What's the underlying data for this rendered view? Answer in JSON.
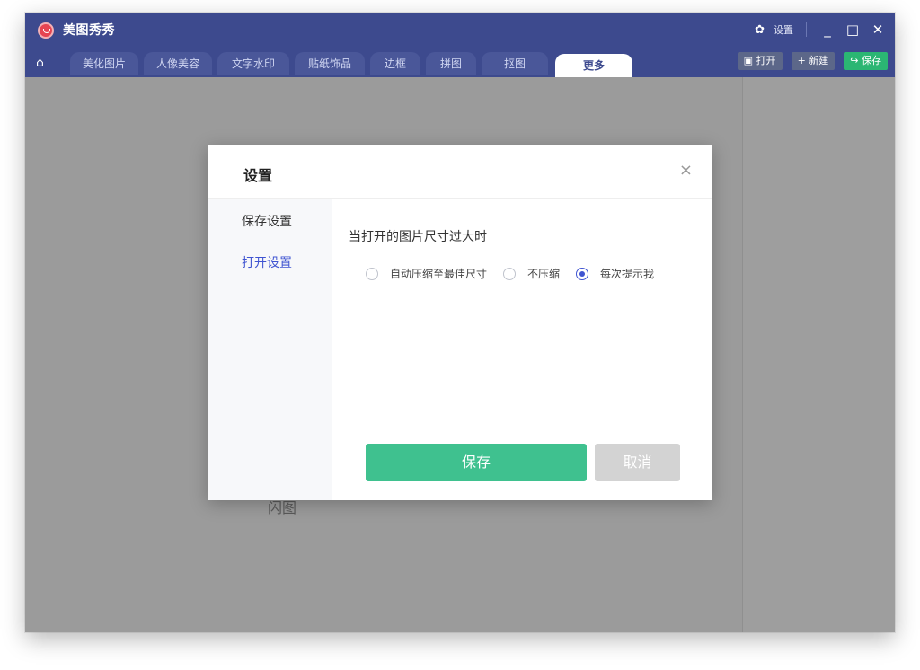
{
  "app": {
    "title": "美图秀秀",
    "settings_label": "设置",
    "window_controls": {
      "minimize": "_",
      "maximize": "□",
      "close": "✕"
    }
  },
  "tabs": {
    "items": [
      "美化图片",
      "人像美容",
      "文字水印",
      "贴纸饰品",
      "边框",
      "拼图",
      "抠图",
      "更多"
    ],
    "active": "更多"
  },
  "actions": {
    "open": "打开",
    "new": "+ 新建",
    "save": "保存"
  },
  "canvas": {
    "background_label": "闪图"
  },
  "dialog": {
    "title": "设置",
    "close": "×",
    "sidebar": {
      "items": [
        "保存设置",
        "打开设置"
      ],
      "active": "打开设置"
    },
    "section_label": "当打开的图片尺寸过大时",
    "options": [
      {
        "label": "自动压缩至最佳尺寸",
        "checked": false
      },
      {
        "label": "不压缩",
        "checked": false
      },
      {
        "label": "每次提示我",
        "checked": true
      }
    ],
    "save_button": "保存",
    "cancel_button": "取消"
  },
  "colors": {
    "titlebar": "#3d4a8e",
    "accent": "#3f54d1",
    "save_green": "#3fc18f",
    "cancel_gray": "#d3d3d3"
  }
}
